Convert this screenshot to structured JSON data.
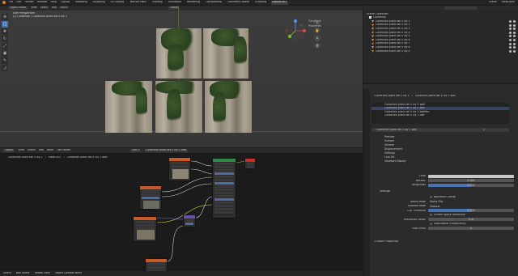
{
  "menubar": {
    "menus": [
      "File",
      "Edit",
      "Render",
      "Window",
      "Help"
    ],
    "workspaces": [
      "Layout",
      "Modeling",
      "Sculpting",
      "UV Editing",
      "Texture Paint",
      "Shading",
      "Animation",
      "Rendering",
      "Compositing",
      "Geometry Nodes",
      "Scripting",
      "Layout.001"
    ],
    "active_workspace": "Layout.001",
    "scene": "Scene",
    "view_layer": "ViewLayer"
  },
  "viewport": {
    "mode": "Object Mode",
    "menu": [
      "View",
      "Select",
      "Add",
      "Object"
    ],
    "orientation": "Global",
    "overlay_line1": "User Perspective",
    "overlay_line2": "(1) Collection | Collection plant set 4 ivy 1",
    "npanel_tabs": [
      "Transform",
      "Properties"
    ],
    "toolbar": [
      {
        "icon": "cursor-icon",
        "active": false
      },
      {
        "icon": "select-icon",
        "active": true
      },
      {
        "icon": "move-icon",
        "active": false
      },
      {
        "icon": "rotate-icon",
        "active": false
      },
      {
        "icon": "scale-icon",
        "active": false
      },
      {
        "icon": "transform-icon",
        "active": false
      },
      {
        "icon": "annotate-icon",
        "active": false
      },
      {
        "icon": "measure-icon",
        "active": false
      }
    ]
  },
  "outliner": {
    "title": "Scene Collection",
    "collection": "Collection",
    "items": [
      "Collection plant set 4 ivy 1",
      "Collection plant set 4 ivy 2",
      "Collection plant set 4 ivy 3",
      "Collection plant set 4 ivy 4",
      "Collection plant set 4 ivy 5",
      "Collection plant set 4 ivy 6",
      "Collection plant set 4 ivy 7",
      "Collection plant set 4 ivy 8",
      "Collection plant set 4 ivy 9"
    ]
  },
  "properties": {
    "breadcrumb_object": "Collection plant set 4 ivy 1",
    "breadcrumb_material": "Collection plant set 4 ivy 1 wall",
    "material_slots": [
      "Collection plant set 4 ivy 1 wall",
      "Collection plant set 4 ivy 1 wall",
      "Collection plant set 4 ivy 1 leaflets",
      "Collection plant set 4 ivy 1 leaf"
    ],
    "active_material": "Collection plant set 4 ivy 1 wall",
    "users": "2",
    "sections": [
      "Preview",
      "Surface",
      "Volume",
      "Displacement",
      "Settings",
      "Line Art",
      "Viewport Display"
    ],
    "viewport_display": {
      "color_label": "Color",
      "metallic_label": "Metallic",
      "metallic_value": "0.000",
      "roughness_label": "Roughness",
      "roughness_value": "0.500"
    },
    "settings": {
      "title": "Settings",
      "backface_culling": "Backface Culling",
      "blend_mode_label": "Blend Mode",
      "blend_mode_value": "Alpha Clip",
      "shadow_mode_label": "Shadow Mode",
      "shadow_mode_value": "Opaque",
      "clip_threshold_label": "Clip Threshold",
      "clip_threshold_value": "0.500",
      "clip_threshold_fraction": 0.5,
      "screen_space_refraction": "Screen Space Refraction",
      "refraction_depth_label": "Refraction Depth",
      "refraction_depth_value": "0 m",
      "subsurface_translucency": "Subsurface Translucency",
      "pass_index_label": "Pass Index",
      "pass_index_value": "0"
    },
    "custom_properties": "Custom Properties"
  },
  "node_editor": {
    "editor": "Object",
    "menu": [
      "View",
      "Select",
      "Add",
      "Node"
    ],
    "use_nodes": "Use Nodes",
    "slot": "Slot 1",
    "material": "Collection plant set 4 ivy 1 wall",
    "breadcrumb": [
      "Collection plant set 4 ivy 1",
      "Mesh.001",
      "Collection plant set 4 ivy 1 wall"
    ]
  },
  "statusbar": {
    "items": [
      "Select",
      "Box Select",
      "Rotate View",
      "Object Context Menu"
    ]
  },
  "colors": {
    "accent_blue": "#4772b3",
    "orange": "#e87d0d",
    "node_texture": "#c85a2a",
    "node_shader": "#2f8a4a",
    "node_vector": "#6a4fa8"
  }
}
